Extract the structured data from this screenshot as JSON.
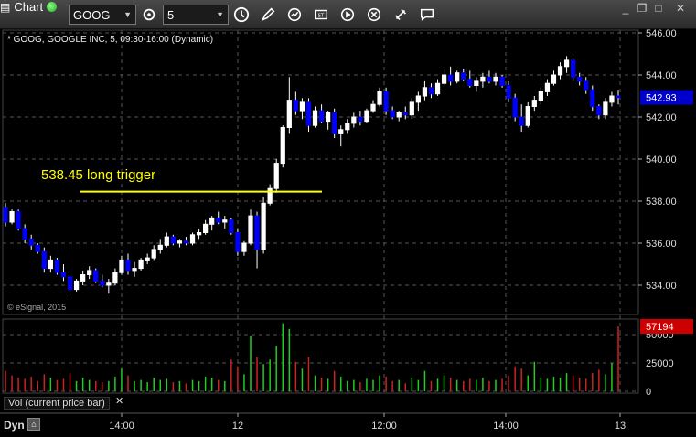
{
  "app": {
    "title": "Chart"
  },
  "toolbar": {
    "symbol_value": "GOOG",
    "interval_value": "5",
    "icons": [
      "gear-icon",
      "clock-icon",
      "pencil-icon",
      "refresh-icon",
      "study-icon",
      "play-icon",
      "delete-icon",
      "link-icon",
      "comment-icon"
    ]
  },
  "header": {
    "caption": "* GOOG, GOOGLE INC, 5, 09:30-16:00 (Dynamic)"
  },
  "watermark": "© eSignal, 2015",
  "annotation": {
    "text": "538.45 long trigger",
    "level": 538.45,
    "color": "#ffff00"
  },
  "price_axis": {
    "labels": [
      "546.00",
      "544.00",
      "542.00",
      "540.00",
      "538.00",
      "536.00",
      "534.00"
    ],
    "current": "542.93",
    "current_value": 542.93
  },
  "volume_axis": {
    "labels": [
      "50000",
      "25000",
      "0"
    ],
    "current": "57194"
  },
  "volume_panel": {
    "label": "Vol (current price bar)"
  },
  "time_axis": {
    "labels": [
      "14:00",
      "12",
      "12:00",
      "14:00",
      "13"
    ]
  },
  "footer": {
    "dyn_label": "Dyn"
  },
  "colors": {
    "up": "#ffffff",
    "down": "#0000ff",
    "vol_up": "#22cc22",
    "vol_down": "#cc2222",
    "grid": "#555555",
    "current_price_bg": "#0000cc",
    "current_vol_bg": "#cc0000"
  },
  "chart_data": {
    "type": "candlestick",
    "ylim": [
      533,
      546.5
    ],
    "ohlc": [
      [
        537.7,
        537.9,
        536.8,
        537.0
      ],
      [
        537.0,
        537.6,
        536.9,
        537.5
      ],
      [
        537.5,
        537.6,
        536.6,
        536.7
      ],
      [
        536.7,
        536.9,
        536.0,
        536.2
      ],
      [
        536.2,
        536.4,
        535.7,
        535.9
      ],
      [
        535.9,
        536.0,
        535.5,
        535.6
      ],
      [
        535.6,
        535.8,
        534.6,
        534.8
      ],
      [
        534.8,
        535.4,
        534.6,
        535.2
      ],
      [
        535.2,
        535.3,
        534.5,
        534.6
      ],
      [
        534.6,
        535.0,
        534.2,
        534.4
      ],
      [
        534.4,
        534.5,
        533.5,
        533.8
      ],
      [
        533.8,
        534.3,
        533.7,
        534.2
      ],
      [
        534.2,
        534.7,
        534.0,
        534.5
      ],
      [
        534.5,
        534.9,
        534.3,
        534.7
      ],
      [
        534.7,
        534.8,
        534.1,
        534.2
      ],
      [
        534.2,
        534.5,
        533.9,
        534.0
      ],
      [
        534.0,
        534.3,
        533.6,
        534.1
      ],
      [
        534.1,
        534.8,
        534.0,
        534.6
      ],
      [
        534.6,
        535.4,
        534.5,
        535.2
      ],
      [
        535.2,
        535.5,
        534.5,
        534.7
      ],
      [
        534.7,
        535.1,
        534.4,
        534.8
      ],
      [
        534.8,
        535.3,
        534.7,
        535.2
      ],
      [
        535.2,
        535.5,
        535.0,
        535.3
      ],
      [
        535.3,
        535.9,
        535.2,
        535.7
      ],
      [
        535.7,
        536.2,
        535.5,
        535.9
      ],
      [
        535.9,
        536.5,
        535.8,
        536.3
      ],
      [
        536.3,
        536.4,
        535.9,
        536.0
      ],
      [
        536.0,
        536.2,
        535.8,
        536.1
      ],
      [
        536.1,
        536.3,
        535.9,
        536.0
      ],
      [
        536.0,
        536.5,
        535.9,
        536.4
      ],
      [
        536.4,
        536.7,
        536.2,
        536.5
      ],
      [
        536.5,
        537.1,
        536.4,
        536.9
      ],
      [
        536.9,
        537.3,
        536.6,
        537.2
      ],
      [
        537.2,
        537.5,
        536.9,
        537.0
      ],
      [
        537.0,
        537.3,
        536.7,
        537.1
      ],
      [
        537.1,
        537.2,
        536.4,
        536.5
      ],
      [
        536.5,
        536.7,
        535.4,
        535.6
      ],
      [
        535.6,
        536.1,
        535.4,
        536.0
      ],
      [
        536.0,
        537.6,
        535.9,
        537.3
      ],
      [
        537.3,
        537.5,
        534.8,
        535.7
      ],
      [
        535.7,
        538.2,
        535.5,
        537.9
      ],
      [
        537.9,
        538.8,
        537.8,
        538.6
      ],
      [
        538.6,
        540.0,
        538.4,
        539.8
      ],
      [
        539.8,
        541.6,
        539.6,
        541.5
      ],
      [
        541.5,
        543.9,
        541.2,
        542.8
      ],
      [
        542.8,
        543.2,
        542.1,
        542.3
      ],
      [
        542.3,
        542.9,
        541.9,
        542.7
      ],
      [
        542.7,
        542.9,
        541.3,
        541.6
      ],
      [
        541.6,
        542.5,
        541.5,
        542.3
      ],
      [
        542.3,
        542.6,
        541.7,
        541.8
      ],
      [
        541.8,
        542.3,
        541.4,
        542.2
      ],
      [
        542.2,
        542.4,
        541.0,
        541.2
      ],
      [
        541.2,
        541.6,
        540.6,
        541.4
      ],
      [
        541.4,
        541.9,
        541.2,
        541.7
      ],
      [
        541.7,
        542.2,
        541.5,
        542.0
      ],
      [
        542.0,
        542.3,
        541.6,
        541.8
      ],
      [
        541.8,
        542.4,
        541.7,
        542.3
      ],
      [
        542.3,
        542.8,
        542.2,
        542.6
      ],
      [
        542.6,
        543.4,
        542.5,
        543.2
      ],
      [
        543.2,
        543.4,
        542.1,
        542.3
      ],
      [
        542.3,
        542.5,
        541.9,
        542.0
      ],
      [
        542.0,
        542.3,
        541.8,
        542.2
      ],
      [
        542.2,
        542.5,
        541.9,
        542.1
      ],
      [
        542.1,
        542.9,
        541.9,
        542.7
      ],
      [
        542.7,
        543.2,
        542.3,
        543.0
      ],
      [
        543.0,
        543.7,
        542.8,
        543.4
      ],
      [
        543.4,
        543.6,
        542.9,
        543.1
      ],
      [
        543.1,
        543.8,
        543.0,
        543.6
      ],
      [
        543.6,
        544.3,
        543.5,
        544.0
      ],
      [
        544.0,
        544.4,
        543.5,
        543.7
      ],
      [
        543.7,
        544.2,
        543.6,
        544.1
      ],
      [
        544.1,
        544.3,
        543.7,
        543.8
      ],
      [
        543.8,
        544.2,
        543.4,
        543.5
      ],
      [
        543.5,
        543.9,
        543.2,
        543.7
      ],
      [
        543.7,
        544.1,
        543.4,
        543.9
      ],
      [
        543.9,
        544.2,
        543.6,
        543.7
      ],
      [
        543.7,
        544.1,
        543.5,
        543.9
      ],
      [
        543.9,
        544.0,
        543.4,
        543.5
      ],
      [
        543.5,
        543.7,
        542.7,
        542.9
      ],
      [
        542.9,
        543.1,
        541.8,
        542.0
      ],
      [
        542.0,
        542.6,
        541.3,
        541.6
      ],
      [
        541.6,
        542.7,
        541.5,
        542.5
      ],
      [
        542.5,
        543.0,
        542.3,
        542.8
      ],
      [
        542.8,
        543.4,
        542.6,
        543.2
      ],
      [
        543.2,
        543.8,
        543.0,
        543.6
      ],
      [
        543.6,
        544.2,
        543.5,
        544.0
      ],
      [
        544.0,
        544.6,
        543.8,
        544.4
      ],
      [
        544.4,
        544.9,
        544.1,
        544.7
      ],
      [
        544.7,
        544.8,
        543.7,
        543.9
      ],
      [
        543.9,
        544.1,
        543.5,
        543.7
      ],
      [
        543.7,
        543.9,
        543.1,
        543.3
      ],
      [
        543.3,
        543.5,
        542.3,
        542.5
      ],
      [
        542.5,
        542.6,
        541.9,
        542.1
      ],
      [
        542.1,
        542.9,
        541.9,
        542.7
      ],
      [
        542.7,
        543.2,
        542.5,
        543.0
      ],
      [
        543.0,
        543.3,
        542.6,
        542.93
      ]
    ],
    "volume": [
      [
        18000,
        "down"
      ],
      [
        14000,
        "down"
      ],
      [
        12000,
        "down"
      ],
      [
        11000,
        "down"
      ],
      [
        13000,
        "down"
      ],
      [
        9000,
        "down"
      ],
      [
        15000,
        "down"
      ],
      [
        12000,
        "up"
      ],
      [
        10000,
        "down"
      ],
      [
        11000,
        "down"
      ],
      [
        16000,
        "down"
      ],
      [
        9000,
        "up"
      ],
      [
        12000,
        "up"
      ],
      [
        10000,
        "up"
      ],
      [
        9000,
        "down"
      ],
      [
        8000,
        "down"
      ],
      [
        9000,
        "up"
      ],
      [
        13000,
        "up"
      ],
      [
        20000,
        "up"
      ],
      [
        14000,
        "down"
      ],
      [
        9000,
        "up"
      ],
      [
        10000,
        "up"
      ],
      [
        8000,
        "up"
      ],
      [
        12000,
        "up"
      ],
      [
        10000,
        "up"
      ],
      [
        11000,
        "up"
      ],
      [
        8000,
        "down"
      ],
      [
        9000,
        "up"
      ],
      [
        7000,
        "down"
      ],
      [
        10000,
        "up"
      ],
      [
        9000,
        "up"
      ],
      [
        13000,
        "up"
      ],
      [
        12000,
        "up"
      ],
      [
        10000,
        "down"
      ],
      [
        9000,
        "up"
      ],
      [
        28000,
        "down"
      ],
      [
        22000,
        "down"
      ],
      [
        15000,
        "up"
      ],
      [
        49000,
        "up"
      ],
      [
        30000,
        "down"
      ],
      [
        24000,
        "up"
      ],
      [
        28000,
        "up"
      ],
      [
        40000,
        "up"
      ],
      [
        60000,
        "up"
      ],
      [
        55000,
        "up"
      ],
      [
        26000,
        "down"
      ],
      [
        20000,
        "up"
      ],
      [
        30000,
        "down"
      ],
      [
        14000,
        "up"
      ],
      [
        12000,
        "down"
      ],
      [
        11000,
        "up"
      ],
      [
        18000,
        "down"
      ],
      [
        13000,
        "up"
      ],
      [
        9000,
        "up"
      ],
      [
        10000,
        "up"
      ],
      [
        8000,
        "down"
      ],
      [
        11000,
        "up"
      ],
      [
        10000,
        "up"
      ],
      [
        14000,
        "up"
      ],
      [
        13000,
        "down"
      ],
      [
        9000,
        "down"
      ],
      [
        10000,
        "up"
      ],
      [
        7000,
        "down"
      ],
      [
        12000,
        "up"
      ],
      [
        10000,
        "up"
      ],
      [
        18000,
        "up"
      ],
      [
        9000,
        "down"
      ],
      [
        11000,
        "up"
      ],
      [
        14000,
        "up"
      ],
      [
        12000,
        "down"
      ],
      [
        10000,
        "up"
      ],
      [
        9000,
        "down"
      ],
      [
        11000,
        "down"
      ],
      [
        10000,
        "up"
      ],
      [
        12000,
        "up"
      ],
      [
        9000,
        "down"
      ],
      [
        10000,
        "up"
      ],
      [
        11000,
        "down"
      ],
      [
        14000,
        "down"
      ],
      [
        22000,
        "down"
      ],
      [
        20000,
        "down"
      ],
      [
        14000,
        "up"
      ],
      [
        26000,
        "up"
      ],
      [
        12000,
        "up"
      ],
      [
        11000,
        "up"
      ],
      [
        13000,
        "up"
      ],
      [
        12000,
        "up"
      ],
      [
        16000,
        "up"
      ],
      [
        14000,
        "down"
      ],
      [
        12000,
        "down"
      ],
      [
        11000,
        "down"
      ],
      [
        16000,
        "down"
      ],
      [
        19000,
        "down"
      ],
      [
        15000,
        "up"
      ],
      [
        25000,
        "up"
      ],
      [
        57194,
        "down"
      ]
    ]
  }
}
